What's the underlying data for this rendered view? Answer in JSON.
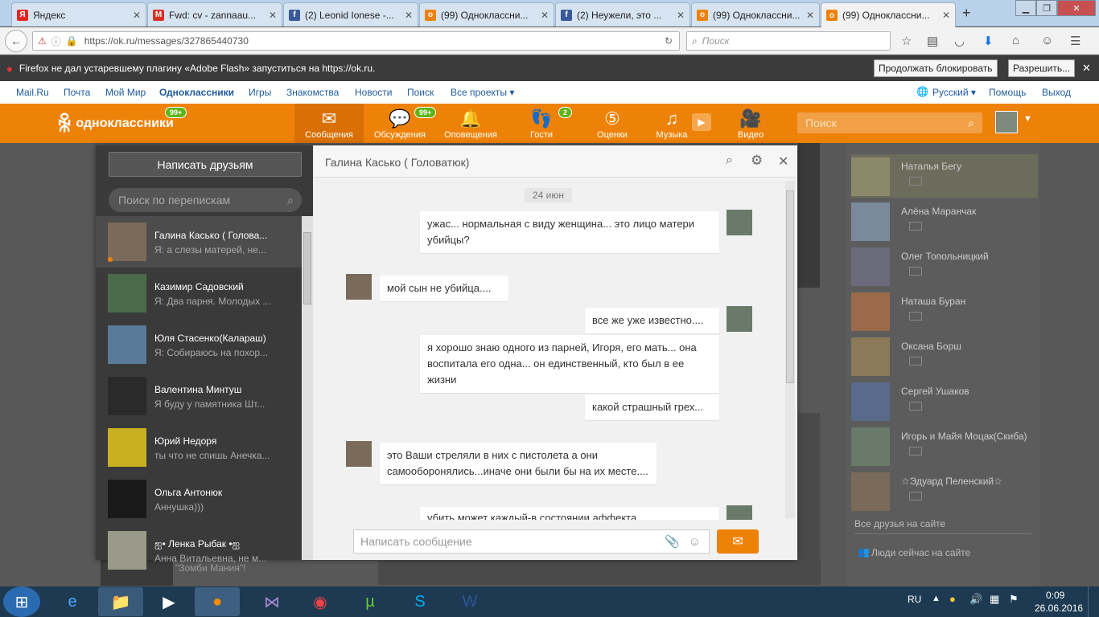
{
  "browser": {
    "tabs": [
      {
        "label": "Яндекс",
        "fav": "Я",
        "color": "#e52620"
      },
      {
        "label": "Fwd: cv - zannaau...",
        "fav": "M",
        "color": "#d93025"
      },
      {
        "label": "(2) Leonid Ionese -...",
        "fav": "f",
        "color": "#3b5998"
      },
      {
        "label": "(99) Одноклассни...",
        "fav": "о",
        "color": "#ee8208"
      },
      {
        "label": "(2) Неужели, это ...",
        "fav": "f",
        "color": "#3b5998"
      },
      {
        "label": "(99) Одноклассни...",
        "fav": "о",
        "color": "#ee8208"
      },
      {
        "label": "(99) Одноклассни...",
        "fav": "о",
        "color": "#ee8208"
      }
    ],
    "new_tab": "+",
    "url": "https://ok.ru/messages/327865440730",
    "search_placeholder": "Поиск",
    "flash_message": "Firefox не дал устаревшему плагину «Adobe Flash» запуститься на https://ok.ru.",
    "flash_block": "Продолжать блокировать",
    "flash_allow": "Разрешить..."
  },
  "portal": {
    "links": [
      "Mail.Ru",
      "Почта",
      "Мой Мир",
      "Одноклассники",
      "Игры",
      "Знакомства",
      "Новости",
      "Поиск",
      "Все проекты ▾"
    ],
    "language": "Русский ▾",
    "help": "Помощь",
    "logout": "Выход"
  },
  "ok": {
    "logo": "одноклассники",
    "logo_badge": "99+",
    "nav": [
      {
        "label": "Сообщения",
        "icon": "✉"
      },
      {
        "label": "Обсуждения",
        "icon": "💬",
        "badge": "99+"
      },
      {
        "label": "Оповещения",
        "icon": "🔔"
      },
      {
        "label": "Гости",
        "icon": "👣",
        "badge": "2"
      },
      {
        "label": "Оценки",
        "icon": "⑤"
      },
      {
        "label": "Музыка",
        "icon": "♫"
      },
      {
        "label": "Видео",
        "icon": "🎥"
      }
    ],
    "search_placeholder": "Поиск",
    "brand_color": "#ee8208"
  },
  "messenger": {
    "write_friends": "Написать друзьям",
    "search_placeholder": "Поиск по перепискам",
    "conversations": [
      {
        "name": "Галина Касько ( Голова...",
        "preview": "Я: а слезы матерей, не..."
      },
      {
        "name": "Казимир Садовский",
        "preview": "Я: Два парня. Молодых ..."
      },
      {
        "name": "Юля Стасенко(Калараш)",
        "preview": "Я: Собираюсь на похор..."
      },
      {
        "name": "Валентина Минтуш",
        "preview": "Я буду у памятника Шт..."
      },
      {
        "name": "Юрий Недоря",
        "preview": "ты что не спишь Анечка..."
      },
      {
        "name": "Ольга Антонюк",
        "preview": "Аннушка)))"
      },
      {
        "name": "ஐ• Ленка Рыбак •ஐ",
        "preview": "Анна Витальевна, не м..."
      }
    ],
    "chat_title": "Галина Касько ( Головатюк)",
    "date": "24 июн",
    "messages": [
      {
        "text": "ужас... нормальная с виду женщина... это лицо матери убийцы?",
        "mine": true
      },
      {
        "text": "мой сын не убийца....",
        "mine": false
      },
      {
        "text": "все же уже известно....",
        "mine": true
      },
      {
        "text": "я хорошо знаю одного из парней, Игоря, его мать... она воспитала его одна... он единственный, кто был в ее жизни",
        "mine": true
      },
      {
        "text": "какой страшный грех...",
        "mine": true
      },
      {
        "text": "это Ваши стреляли в них с пистолета а они самооборонялись...иначе они были бы на их месте....",
        "mine": false
      },
      {
        "text": "убить может каждый-в состоянии аффекта.",
        "mine": true
      }
    ],
    "compose_placeholder": "Написать сообщение"
  },
  "right_column": {
    "friends": [
      "Наталья Бегу",
      "Алёна Маранчак",
      "Олег Топольницкий",
      "Наташа Буран",
      "Оксана Борш",
      "Сергей Ушаков",
      "Игорь и Майя Моцак(Скиба)",
      "☆Эдуард Пеленский☆"
    ],
    "all_friends": "Все друзья на сайте",
    "people_now": "Люди сейчас на сайте"
  },
  "background_text": "\"Зомби Мания\"!",
  "taskbar": {
    "lang": "RU",
    "time": "0:09",
    "date": "26.06.2016"
  }
}
